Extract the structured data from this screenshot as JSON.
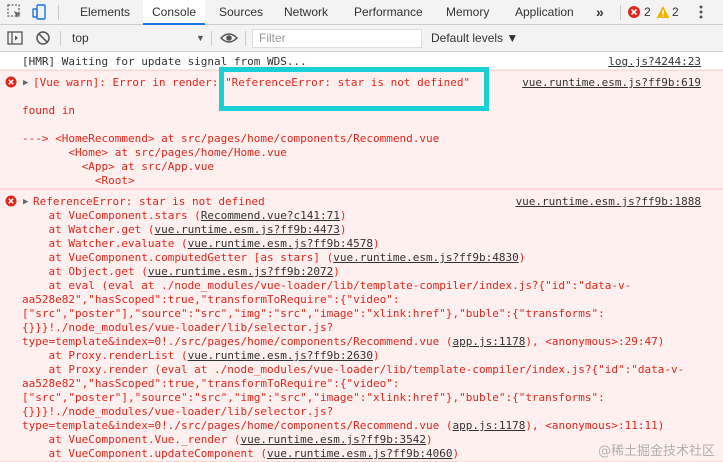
{
  "tabs": [
    "Elements",
    "Console",
    "Sources",
    "Network",
    "Performance",
    "Memory",
    "Application"
  ],
  "more_tabs": "»",
  "error_count": "2",
  "warning_count": "2",
  "context": "top",
  "filter_placeholder": "Filter",
  "levels": "Default levels ▼",
  "colors": {
    "error": "#e0261c",
    "highlight": "#19d0d6",
    "active_tab": "#1a73e8"
  },
  "console": {
    "hmr": {
      "text": "[HMR] Waiting for update signal from WDS...",
      "src": "log.js?4244:23"
    },
    "vue_warn": {
      "prefix": "[Vue warn]: Error in render: ",
      "quoted": "\"ReferenceError: star is not defined\"",
      "src": "vue.runtime.esm.js?ff9b:619",
      "lines": [
        "found in",
        "",
        "---> <HomeRecommend> at src/pages/home/components/Recommend.vue",
        "       <Home> at src/pages/home/Home.vue",
        "         <App> at src/App.vue",
        "           <Root>"
      ]
    },
    "ref_error": {
      "title": "ReferenceError: star is not defined",
      "src": "vue.runtime.esm.js?ff9b:1888",
      "lines": [
        {
          "pre": "    at VueComponent.stars (",
          "link": "Recommend.vue?c141:71",
          "post": ")"
        },
        {
          "pre": "    at Watcher.get (",
          "link": "vue.runtime.esm.js?ff9b:4473",
          "post": ")"
        },
        {
          "pre": "    at Watcher.evaluate (",
          "link": "vue.runtime.esm.js?ff9b:4578",
          "post": ")"
        },
        {
          "pre": "    at VueComponent.computedGetter [as stars] (",
          "link": "vue.runtime.esm.js?ff9b:4830",
          "post": ")"
        },
        {
          "pre": "    at Object.get (",
          "link": "vue.runtime.esm.js?ff9b:2072",
          "post": ")"
        },
        {
          "pre": "    at eval (eval at ./node_modules/vue-loader/lib/template-compiler/index.js?{\"id\":\"data-v-",
          "link": "",
          "post": ""
        },
        {
          "pre": "aa528e82\",\"hasScoped\":true,\"transformToRequire\":{\"video\":",
          "link": "",
          "post": ""
        },
        {
          "pre": "[\"src\",\"poster\"],\"source\":\"src\",\"img\":\"src\",\"image\":\"xlink:href\"},\"buble\":{\"transforms\":",
          "link": "",
          "post": ""
        },
        {
          "pre": "{}}}!./node_modules/vue-loader/lib/selector.js?",
          "link": "",
          "post": ""
        },
        {
          "pre": "type=template&index=0!./src/pages/home/components/Recommend.vue (",
          "link": "app.js:1178",
          "post": "), <anonymous>:29:47)"
        },
        {
          "pre": "    at Proxy.renderList (",
          "link": "vue.runtime.esm.js?ff9b:2630",
          "post": ")"
        },
        {
          "pre": "    at Proxy.render (eval at ./node_modules/vue-loader/lib/template-compiler/index.js?{\"id\":\"data-v-",
          "link": "",
          "post": ""
        },
        {
          "pre": "aa528e82\",\"hasScoped\":true,\"transformToRequire\":{\"video\":",
          "link": "",
          "post": ""
        },
        {
          "pre": "[\"src\",\"poster\"],\"source\":\"src\",\"img\":\"src\",\"image\":\"xlink:href\"},\"buble\":{\"transforms\":",
          "link": "",
          "post": ""
        },
        {
          "pre": "{}}}!./node_modules/vue-loader/lib/selector.js?",
          "link": "",
          "post": ""
        },
        {
          "pre": "type=template&index=0!./src/pages/home/components/Recommend.vue (",
          "link": "app.js:1178",
          "post": "), <anonymous>:11:11)"
        },
        {
          "pre": "    at VueComponent.Vue._render (",
          "link": "vue.runtime.esm.js?ff9b:3542",
          "post": ")"
        },
        {
          "pre": "    at VueComponent.updateComponent (",
          "link": "vue.runtime.esm.js?ff9b:4060",
          "post": ")"
        }
      ]
    }
  },
  "watermark": "@稀土掘金技术社区"
}
